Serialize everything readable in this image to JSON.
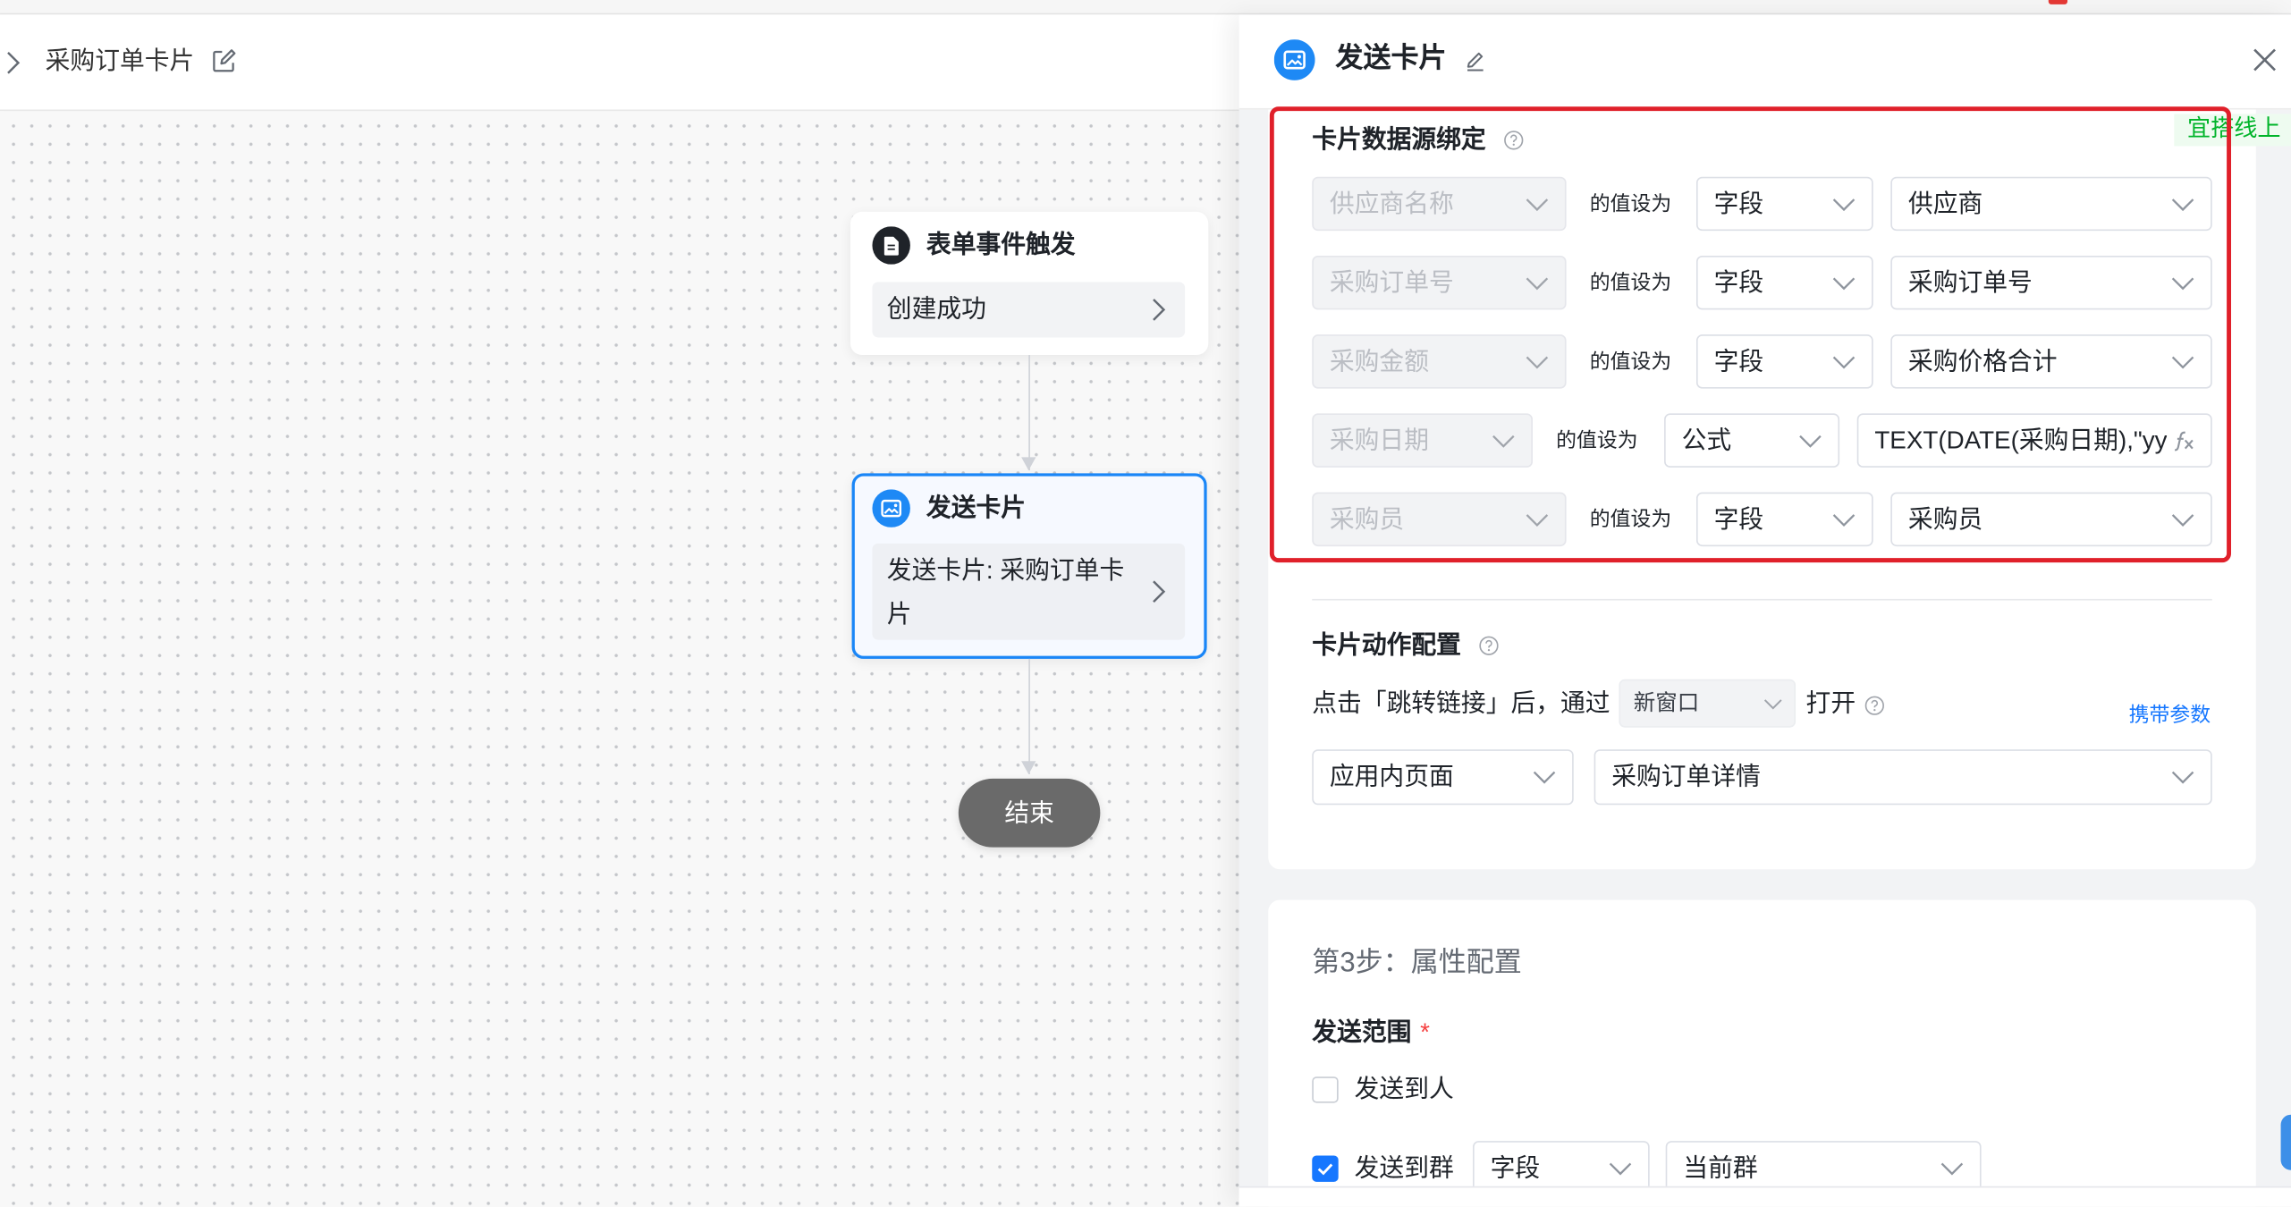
{
  "breadcrumb": {
    "title": "采购订单卡片"
  },
  "flow": {
    "trigger_node": {
      "title": "表单事件触发",
      "detail": "创建成功",
      "icon": "form-doc-icon"
    },
    "send_node": {
      "title": "发送卡片",
      "detail": "发送卡片: 采购订单卡片",
      "icon": "send-card-icon",
      "selected": true
    },
    "end_node": {
      "label": "结束"
    }
  },
  "panel": {
    "title": "发送卡片",
    "env_badge": "宜搭线上",
    "data_binding": {
      "title": "卡片数据源绑定",
      "set_value_label": "的值设为",
      "rows": [
        {
          "field": "供应商名称",
          "type": "字段",
          "value": "供应商"
        },
        {
          "field": "采购订单号",
          "type": "字段",
          "value": "采购订单号"
        },
        {
          "field": "采购金额",
          "type": "字段",
          "value": "采购价格合计"
        },
        {
          "field": "采购日期",
          "type": "公式",
          "value": "TEXT(DATE(采购日期),\"yy"
        },
        {
          "field": "采购员",
          "type": "字段",
          "value": "采购员"
        }
      ]
    },
    "action_config": {
      "title": "卡片动作配置",
      "prefix": "点击「跳转链接」后，通过",
      "open_mode": "新窗口",
      "suffix": "打开",
      "carry_params": "携带参数",
      "page_type": "应用内页面",
      "page": "采购订单详情"
    },
    "step3": {
      "title": "第3步：属性配置",
      "send_scope_label": "发送范围",
      "required_mark": "*",
      "send_to_person": {
        "label": "发送到人",
        "checked": false
      },
      "send_to_group": {
        "label": "发送到群",
        "checked": true,
        "type": "字段",
        "value": "当前群"
      }
    }
  },
  "colors": {
    "accent": "#1677ff",
    "selected_node_border": "#1a86f7",
    "highlight_border": "#e0202a",
    "env_badge": "#00b42a",
    "end_node": "#6a6a6a",
    "required": "#f53f3f"
  }
}
